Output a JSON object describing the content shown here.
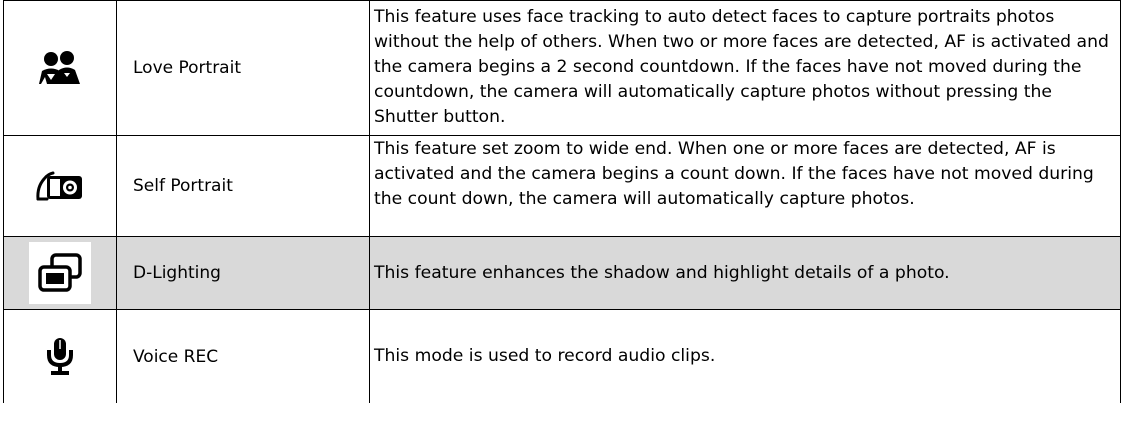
{
  "rows": [
    {
      "icon": "love-portrait-icon",
      "name": "Love Portrait",
      "description": "This feature uses face tracking to auto detect faces to capture portraits photos without the help of others. When two or more faces are detected, AF is activated and the camera begins a 2 second countdown. If the faces have not moved during the countdown, the camera will automatically capture photos without pressing the Shutter button.",
      "shaded": false
    },
    {
      "icon": "self-portrait-icon",
      "name": "Self Portrait",
      "description": "This feature set zoom to wide end. When one or more faces are detected, AF is activated and the camera begins a count down. If the faces have not moved during the count down, the camera will automatically capture photos.",
      "shaded": false
    },
    {
      "icon": "d-lighting-icon",
      "name": "D-Lighting",
      "description": "This feature enhances the shadow and highlight details of a photo.",
      "shaded": true
    },
    {
      "icon": "voice-rec-icon",
      "name": "Voice REC",
      "description": "This mode is used to record audio clips.",
      "shaded": false
    }
  ],
  "colors": {
    "shaded_row": "#d9d9d9",
    "border": "#000000",
    "icon": "#000000"
  }
}
